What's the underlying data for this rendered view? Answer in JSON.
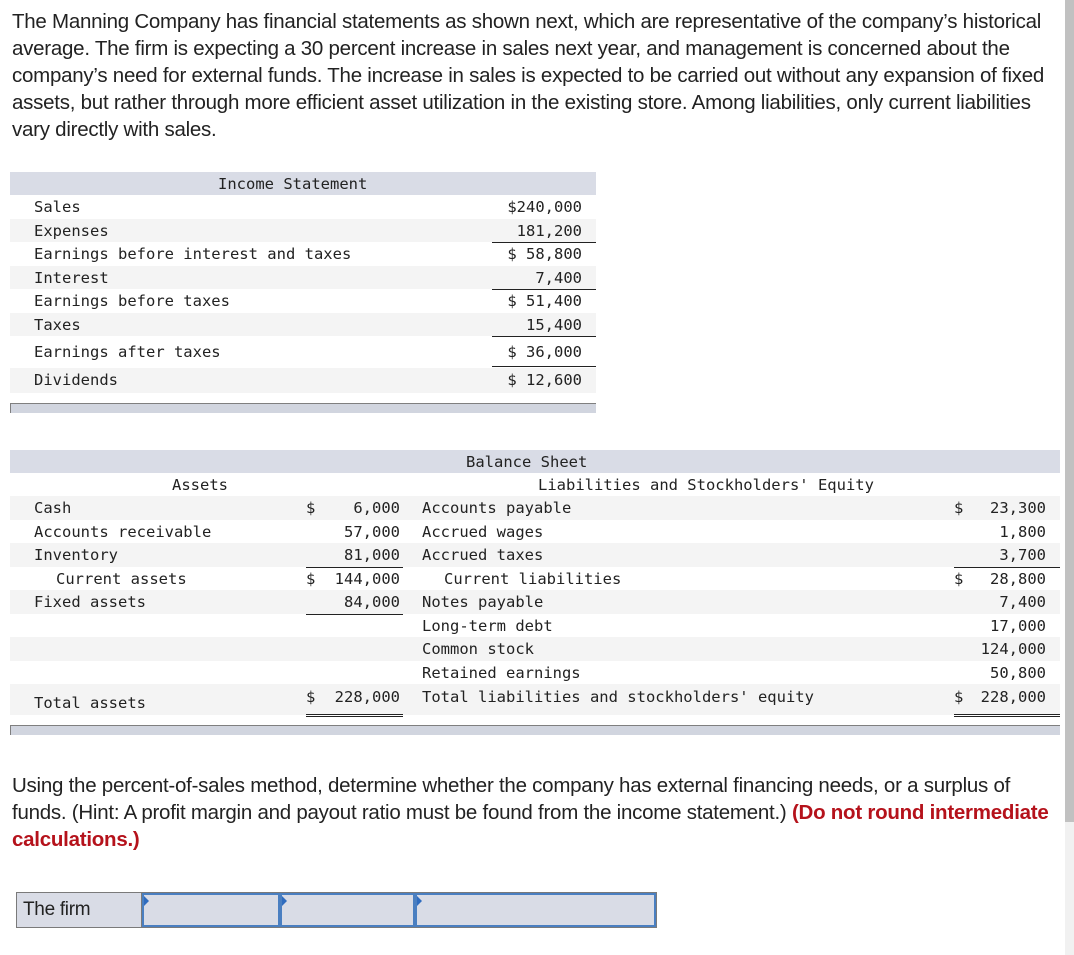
{
  "intro": "The Manning Company has financial statements as shown next, which are representative of the company’s historical average. The firm is expecting a 30 percent increase in sales next year, and management is concerned about the company’s need for external funds. The increase in sales is expected to be carried out without any expansion of fixed assets, but rather through more efficient asset utilization in the existing store. Among liabilities, only current liabilities vary directly with sales.",
  "income_statement": {
    "title": "Income Statement",
    "rows": [
      {
        "label": "Sales",
        "value": "$240,000"
      },
      {
        "label": "Expenses",
        "value": "181,200"
      },
      {
        "label": "Earnings before interest and taxes",
        "value": "$ 58,800"
      },
      {
        "label": "Interest",
        "value": "7,400"
      },
      {
        "label": "Earnings before taxes",
        "value": "$ 51,400"
      },
      {
        "label": "Taxes",
        "value": "15,400"
      },
      {
        "label": "Earnings after taxes",
        "value": "$ 36,000"
      },
      {
        "label": "Dividends",
        "value": "$ 12,600"
      }
    ]
  },
  "balance_sheet": {
    "title": "Balance Sheet",
    "assets_header": "Assets",
    "liabilities_header": "Liabilities and Stockholders' Equity",
    "assets": [
      {
        "label": "Cash",
        "dollar": "$",
        "value": "6,000"
      },
      {
        "label": "Accounts receivable",
        "dollar": "",
        "value": "57,000"
      },
      {
        "label": "Inventory",
        "dollar": "",
        "value": "81,000"
      },
      {
        "label": "Current assets",
        "dollar": "$",
        "value": "144,000"
      },
      {
        "label": "Fixed assets",
        "dollar": "",
        "value": "84,000"
      },
      {
        "label": "Total assets",
        "dollar": "$",
        "value": "228,000"
      }
    ],
    "liabilities": [
      {
        "label": "Accounts payable",
        "dollar": "$",
        "value": "23,300"
      },
      {
        "label": "Accrued wages",
        "dollar": "",
        "value": "1,800"
      },
      {
        "label": "Accrued taxes",
        "dollar": "",
        "value": "3,700"
      },
      {
        "label": "Current liabilities",
        "dollar": "$",
        "value": "28,800"
      },
      {
        "label": "Notes payable",
        "dollar": "",
        "value": "7,400"
      },
      {
        "label": "Long-term debt",
        "dollar": "",
        "value": "17,000"
      },
      {
        "label": "Common stock",
        "dollar": "",
        "value": "124,000"
      },
      {
        "label": "Retained earnings",
        "dollar": "",
        "value": "50,800"
      },
      {
        "label": "Total liabilities and stockholders' equity",
        "dollar": "$",
        "value": "228,000"
      }
    ]
  },
  "question": {
    "text": "Using the percent-of-sales method, determine whether the company has external financing needs, or a surplus of funds. (Hint: A profit margin and payout ratio must be found from the income statement.) ",
    "emphasis": "(Do not round intermediate calculations.)"
  },
  "answer": {
    "label": "The firm",
    "cells": [
      "",
      "",
      ""
    ]
  }
}
